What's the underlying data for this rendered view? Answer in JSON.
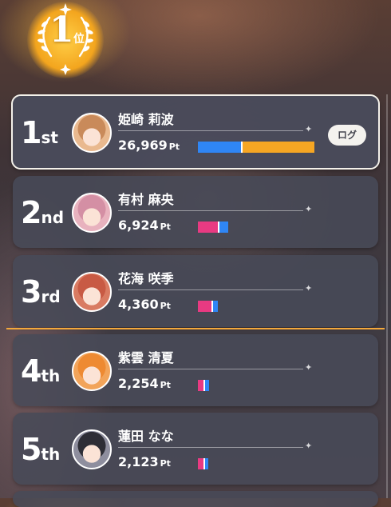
{
  "top_badge": {
    "number": "1",
    "suffix": "位"
  },
  "accent": {
    "pink": "#e83a82",
    "blue": "#2f86f5",
    "orange": "#f6a623",
    "divider": "#f3a83b"
  },
  "log_button": "ログ",
  "rows": [
    {
      "rank_num": "1",
      "rank_suffix": "st",
      "name": "姫崎 莉波",
      "points": "26,969",
      "unit": "Pt",
      "avatar_color": "#e9b98f",
      "hair": "#c98a5a",
      "segments": [
        {
          "color": "#2f86f5",
          "fraction": 0.38
        },
        {
          "color": "#f6a623",
          "fraction": 0.62
        }
      ]
    },
    {
      "rank_num": "2",
      "rank_suffix": "nd",
      "name": "有村 麻央",
      "points": "6,924",
      "unit": "Pt",
      "avatar_color": "#e8b2be",
      "hair": "#d48fa4",
      "segments": [
        {
          "color": "#e83a82",
          "fraction": 0.69
        },
        {
          "color": "#2f86f5",
          "fraction": 0.31
        }
      ]
    },
    {
      "rank_num": "3",
      "rank_suffix": "rd",
      "name": "花海 咲季",
      "points": "4,360",
      "unit": "Pt",
      "avatar_color": "#d97b62",
      "hair": "#c85a44",
      "segments": [
        {
          "color": "#e83a82",
          "fraction": 0.72
        },
        {
          "color": "#2f86f5",
          "fraction": 0.28
        }
      ]
    },
    {
      "rank_num": "4",
      "rank_suffix": "th",
      "name": "紫雲 清夏",
      "points": "2,254",
      "unit": "Pt",
      "avatar_color": "#f2a45a",
      "hair": "#ee8a32",
      "segments": [
        {
          "color": "#e83a82",
          "fraction": 0.6
        },
        {
          "color": "#2f86f5",
          "fraction": 0.4
        }
      ]
    },
    {
      "rank_num": "5",
      "rank_suffix": "th",
      "name": "蓮田 なな",
      "points": "2,123",
      "unit": "Pt",
      "avatar_color": "#8e8e9e",
      "hair": "#2e2e36",
      "segments": [
        {
          "color": "#e83a82",
          "fraction": 0.62
        },
        {
          "color": "#2f86f5",
          "fraction": 0.38
        }
      ]
    }
  ]
}
